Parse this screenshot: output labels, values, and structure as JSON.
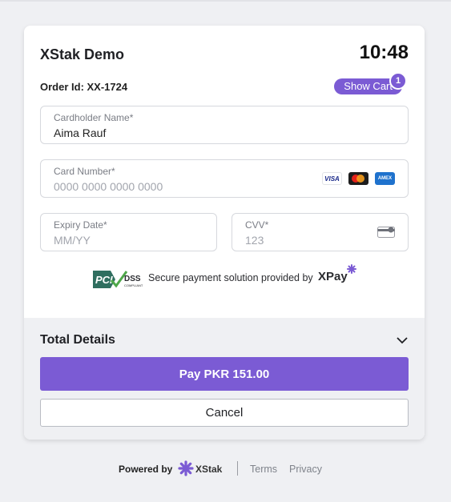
{
  "header": {
    "merchant_name": "XStak Demo",
    "timer": "10:48",
    "order_id": "Order Id: XX-1724",
    "show_cart_label": "Show Cart",
    "cart_count": "1"
  },
  "form": {
    "cardholder": {
      "label": "Cardholder Name*",
      "value": "Aima Rauf"
    },
    "card_number": {
      "label": "Card Number*",
      "placeholder": "0000 0000 0000 0000",
      "brands": [
        "VISA",
        "mastercard-icon",
        "AMEX"
      ]
    },
    "expiry": {
      "label": "Expiry Date*",
      "placeholder": "MM/YY"
    },
    "cvv": {
      "label": "CVV*",
      "placeholder": "123"
    }
  },
  "security": {
    "pci_dss": "DSS",
    "pci_note": "COMPLIANT",
    "text": "Secure payment solution provided by",
    "provider": "XPay"
  },
  "totals": {
    "title": "Total Details",
    "pay_label": "Pay PKR 151.00",
    "cancel_label": "Cancel"
  },
  "footer": {
    "powered_by": "Powered by",
    "brand": "XStak",
    "terms": "Terms",
    "privacy": "Privacy"
  },
  "colors": {
    "accent": "#7b5bd4",
    "background": "#eff0f3"
  }
}
